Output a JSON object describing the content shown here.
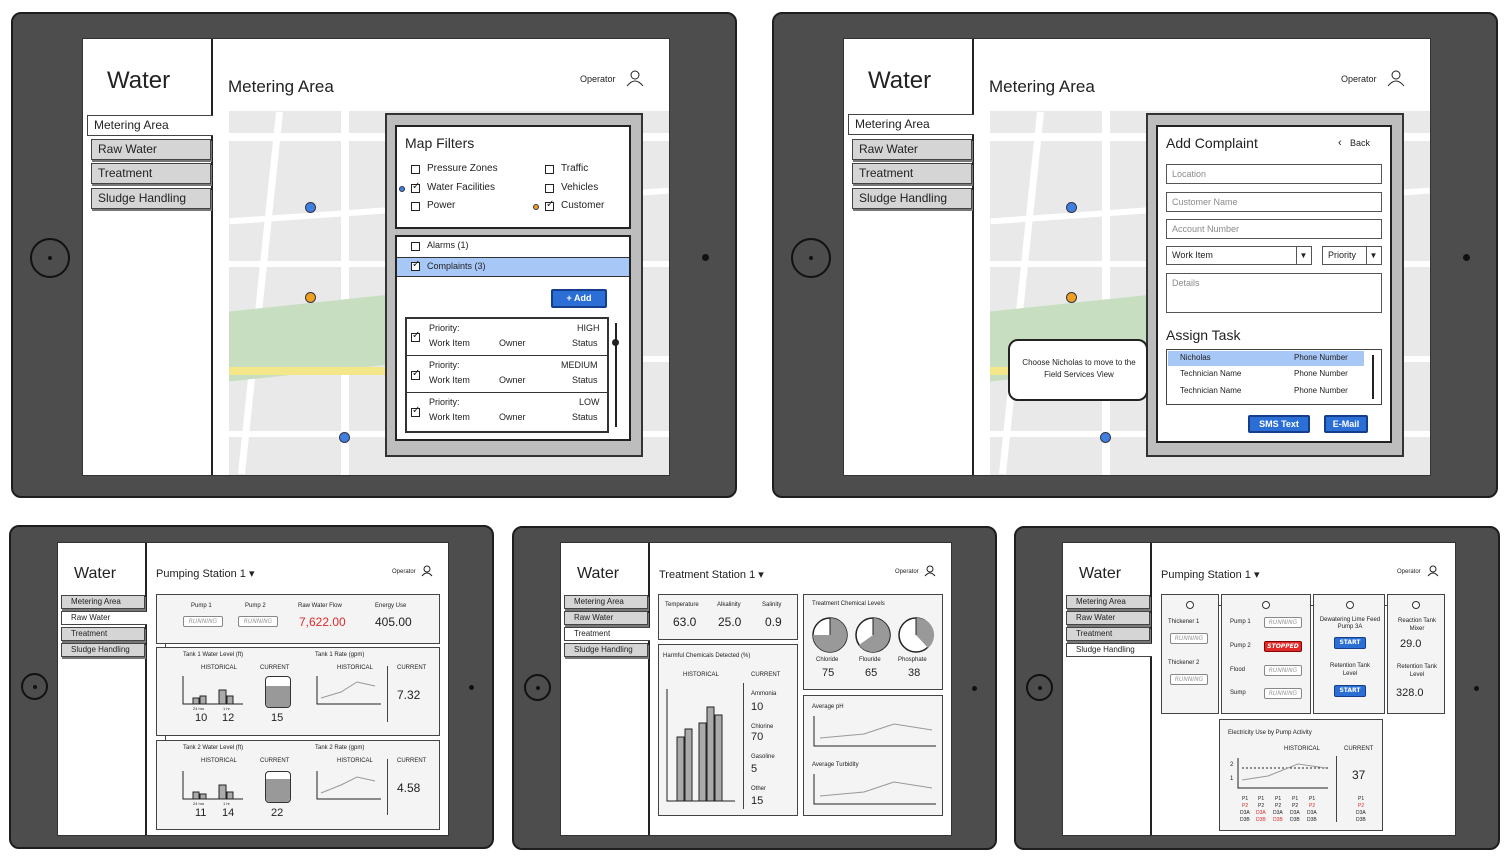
{
  "app_title": "Water",
  "operator_label": "Operator",
  "nav": [
    "Metering Area",
    "Raw Water",
    "Treatment",
    "Sludge Handling"
  ],
  "mockup1": {
    "page_title": "Metering Area",
    "filters": {
      "title": "Map Filters",
      "options": [
        {
          "label": "Pressure Zones",
          "checked": false
        },
        {
          "label": "Water Facilities",
          "checked": true
        },
        {
          "label": "Power",
          "checked": false
        },
        {
          "label": "Traffic",
          "checked": false
        },
        {
          "label": "Vehicles",
          "checked": false
        },
        {
          "label": "Customer",
          "checked": true
        }
      ]
    },
    "alarms": "Alarms (1)",
    "complaints": "Complaints (3)",
    "add_button": "+ Add",
    "items": [
      {
        "priority_label": "Priority:",
        "priority": "HIGH",
        "work_item": "Work Item",
        "owner": "Owner",
        "status": "Status"
      },
      {
        "priority_label": "Priority:",
        "priority": "MEDIUM",
        "work_item": "Work Item",
        "owner": "Owner",
        "status": "Status"
      },
      {
        "priority_label": "Priority:",
        "priority": "LOW",
        "work_item": "Work Item",
        "owner": "Owner",
        "status": "Status"
      }
    ]
  },
  "mockup2": {
    "page_title": "Metering Area",
    "form_title": "Add Complaint",
    "back": "Back",
    "placeholders": {
      "location": "Location",
      "customer": "Customer Name",
      "account": "Account Number",
      "work_item": "Work Item",
      "priority": "Priority",
      "details": "Details"
    },
    "assign_title": "Assign Task",
    "technicians": [
      {
        "name": "Nicholas",
        "phone": "Phone Number",
        "selected": true
      },
      {
        "name": "Technician Name",
        "phone": "Phone Number",
        "selected": false
      },
      {
        "name": "Technician Name",
        "phone": "Phone Number",
        "selected": false
      }
    ],
    "sms": "SMS Text",
    "email": "E-Mail",
    "callout": "Choose Nicholas to move to the Field Services View"
  },
  "mockup3": {
    "page_title": "Pumping Station 1 ▾",
    "pump1": "Pump 1",
    "pump2": "Pump 2",
    "running": "RUNNING",
    "raw_flow_label": "Raw Water Flow",
    "raw_flow": "7,622.00",
    "energy_label": "Energy Use",
    "energy": "405.00",
    "tank1_level": "Tank 1 Water Level (ft)",
    "tank1_rate": "Tank 1 Rate (gpm)",
    "tank2_level": "Tank 2 Water Level (ft)",
    "tank2_rate": "Tank 2 Rate (gpm)",
    "historical": "HISTORICAL",
    "current": "CURRENT",
    "h24": "24 hrs",
    "h1": "1 hr",
    "t1_24": "10",
    "t1_1": "12",
    "t1_cur": "15",
    "t1_rate": "7.32",
    "t2_24": "11",
    "t2_1": "14",
    "t2_cur": "22",
    "t2_rate": "4.58"
  },
  "mockup4": {
    "page_title": "Treatment Station 1 ▾",
    "temp_label": "Temperature",
    "alk_label": "Alkalinity",
    "sal_label": "Salinity",
    "temp": "63.0",
    "alk": "25.0",
    "sal": "0.9",
    "harmful_title": "Harmful Chemicals Detected (%)",
    "historical": "HISTORICAL",
    "current": "CURRENT",
    "chemicals": [
      {
        "name": "Ammonia",
        "value": "10"
      },
      {
        "name": "Chlorine",
        "value": "70"
      },
      {
        "name": "Gasoline",
        "value": "5"
      },
      {
        "name": "Other",
        "value": "15"
      }
    ],
    "levels_title": "Treatment Chemical Levels",
    "levels": [
      {
        "name": "Chloride",
        "value": "75"
      },
      {
        "name": "Flouride",
        "value": "65"
      },
      {
        "name": "Phosphate",
        "value": "38"
      }
    ],
    "avg_ph": "Average pH",
    "avg_turb": "Average Turbidity"
  },
  "mockup5": {
    "page_title": "Pumping Station 1 ▾",
    "thickener1": "Thickener 1",
    "thickener2": "Thickener 2",
    "pump1": "Pump 1",
    "pump2": "Pump 2",
    "flood": "Flood",
    "sump": "Sump",
    "running": "RUNNING",
    "stopped": "STOPPED",
    "start": "START",
    "dewater": "Dewatering Lime Feed Pump 3A",
    "retention": "Retention Tank Level",
    "reaction_mixer": "Reaction Tank Mixer",
    "reaction_mixer_val": "29.0",
    "reaction_level": "Retention Tank Level",
    "reaction_level_val": "328.0",
    "elec_title": "Electricity Use by Pump Activity",
    "historical": "HISTORICAL",
    "current": "CURRENT",
    "elec_current": "37",
    "y2": "2",
    "y1": "1"
  }
}
